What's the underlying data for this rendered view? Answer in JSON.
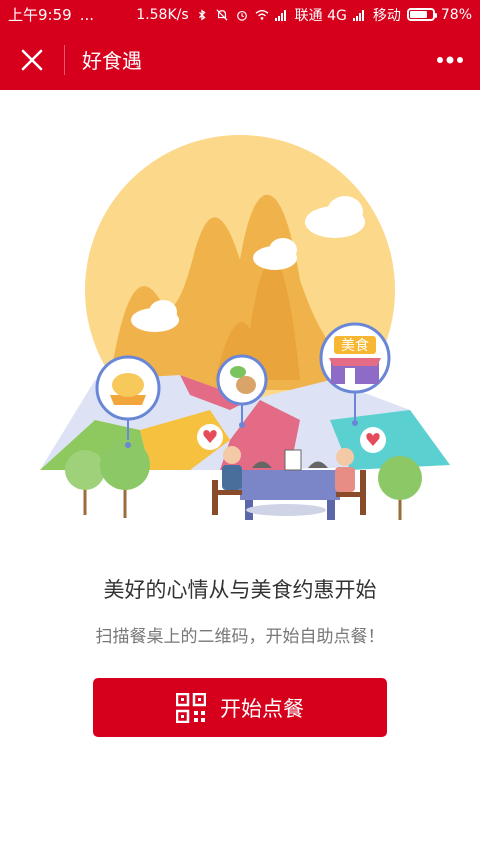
{
  "status_bar": {
    "time": "上午9:59",
    "dots": "...",
    "speed": "1.58K/s",
    "carrier1": "联通 4G",
    "carrier2": "移动",
    "battery": "78%",
    "battery_level": 0.78
  },
  "nav": {
    "title": "好食遇"
  },
  "illustration": {
    "shop_sign": "美食"
  },
  "content": {
    "headline": "美好的心情从与美食约惠开始",
    "subline": "扫描餐桌上的二维码，开始自助点餐！",
    "button_label": "开始点餐"
  },
  "colors": {
    "brand": "#d6001c",
    "sun": "#fbd88a",
    "mountain": "#f0b24a"
  }
}
